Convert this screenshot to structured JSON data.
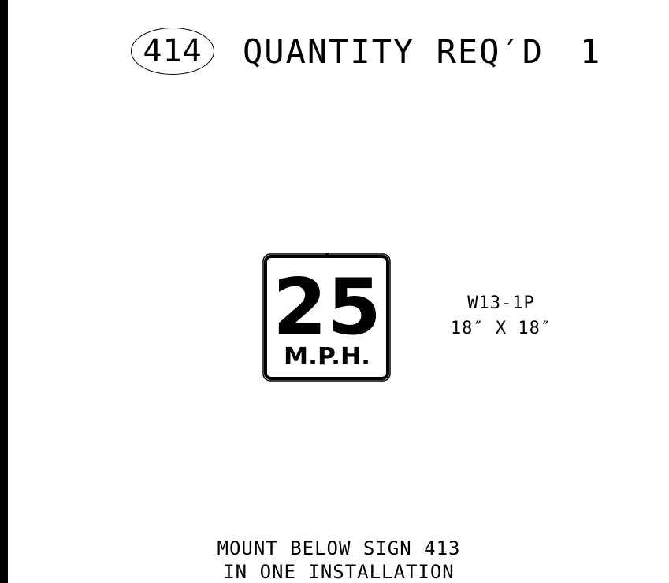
{
  "header": {
    "sign_number": "414",
    "quantity_label": "QUANTITY REQ′D",
    "quantity_value": "1"
  },
  "sign": {
    "speed": "25",
    "unit": "M.P.H.",
    "code": "W13-1P",
    "size": "18″ X 18″"
  },
  "note": {
    "line1": "MOUNT BELOW SIGN 413",
    "line2": "IN ONE INSTALLATION"
  },
  "colors": {
    "sign_background": "#ffffff",
    "sign_legend": "#000000"
  }
}
